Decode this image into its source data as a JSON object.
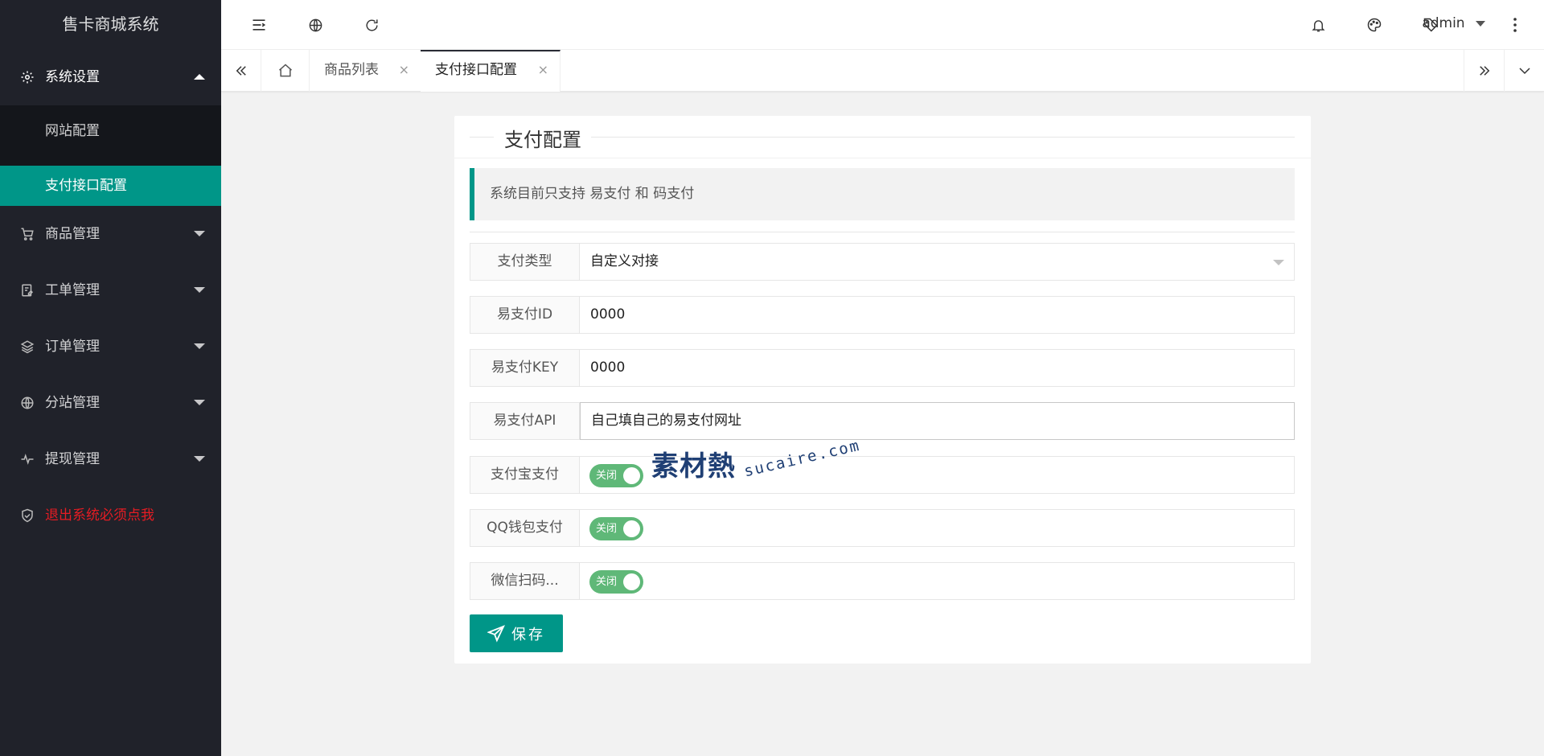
{
  "app": {
    "title": "售卡商城系统"
  },
  "sidebar": {
    "system_settings": "系统设置",
    "sub_items": [
      "网站配置",
      "支付接口配置"
    ],
    "items": [
      {
        "label": "商品管理",
        "icon": "cart-icon"
      },
      {
        "label": "工单管理",
        "icon": "ticket-icon"
      },
      {
        "label": "订单管理",
        "icon": "layers-icon"
      },
      {
        "label": "分站管理",
        "icon": "globe-icon"
      },
      {
        "label": "提现管理",
        "icon": "pulse-icon"
      }
    ],
    "logout": "退出系统必须点我"
  },
  "header": {
    "user": "admin"
  },
  "tabs": [
    {
      "label": "商品列表",
      "close": "×"
    },
    {
      "label": "支付接口配置",
      "close": "×"
    }
  ],
  "card": {
    "title": "支付配置",
    "notice": "系统目前只支持 易支付 和 码支付"
  },
  "form": {
    "pay_type": {
      "label": "支付类型",
      "value": "自定义对接"
    },
    "epay_id": {
      "label": "易支付ID",
      "value": "0000"
    },
    "epay_key": {
      "label": "易支付KEY",
      "value": "0000"
    },
    "epay_api": {
      "label": "易支付API",
      "value": "自己填自己的易支付网址"
    },
    "alipay": {
      "label": "支付宝支付",
      "switch": "关闭"
    },
    "qqpay": {
      "label": "QQ钱包支付",
      "switch": "关闭"
    },
    "wxpay": {
      "label": "微信扫码...",
      "switch": "关闭"
    },
    "save": "保存"
  },
  "watermark": {
    "cn": "素材熱",
    "en": "sucaire.com"
  },
  "colors": {
    "sidebar": "#20222a",
    "accent": "#009688",
    "switch": "#5fb878",
    "danger": "#e51c23"
  }
}
